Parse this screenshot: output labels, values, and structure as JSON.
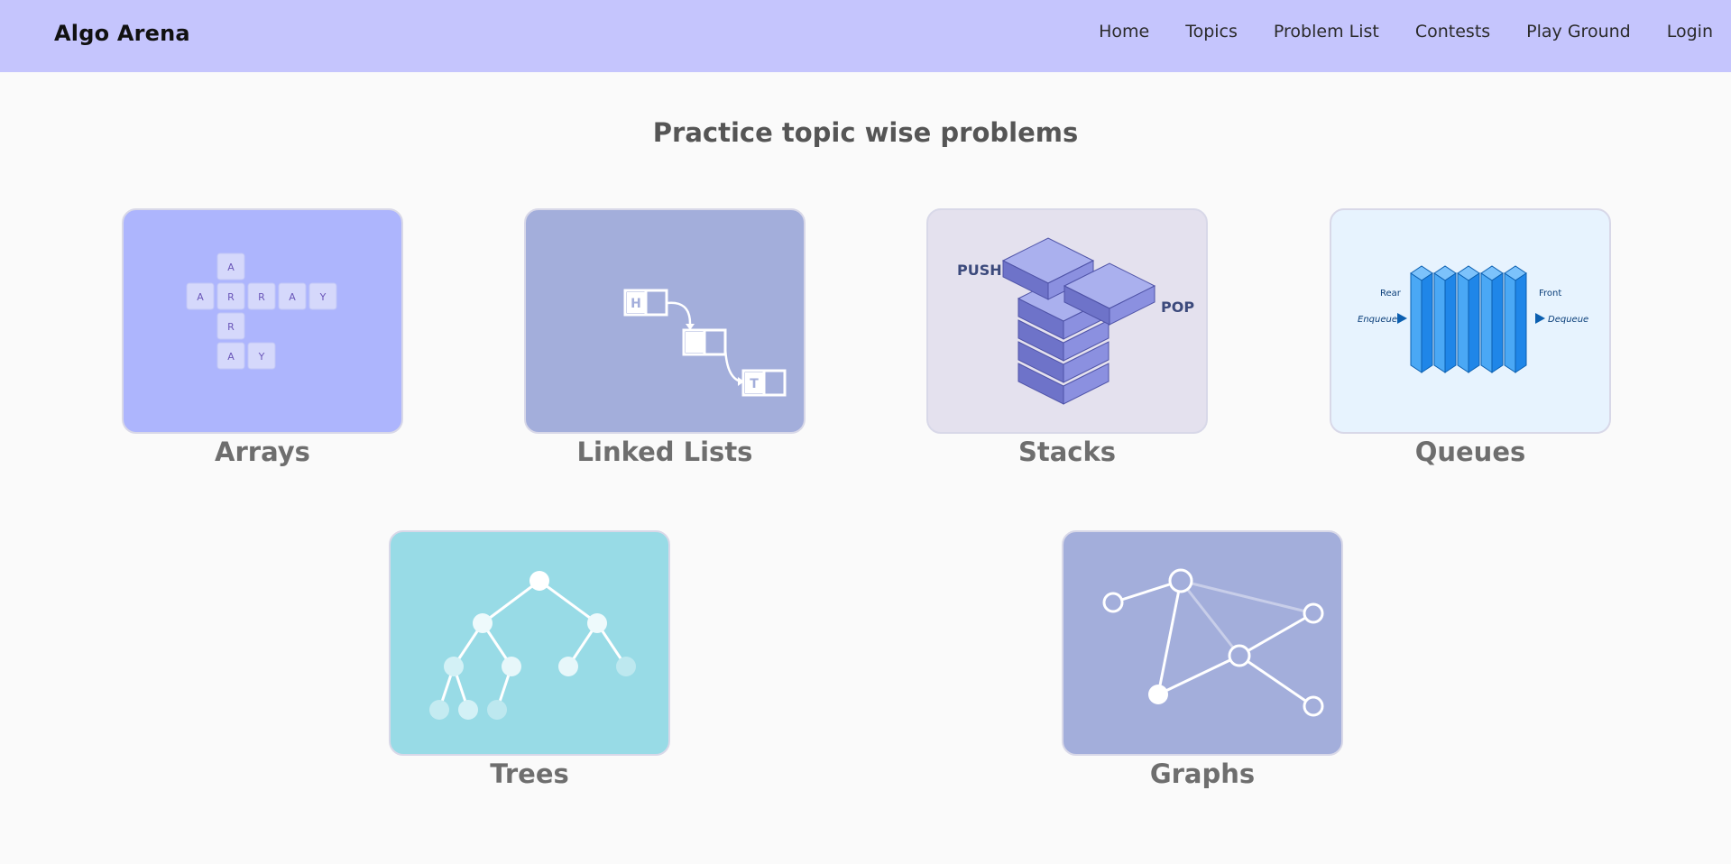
{
  "app": {
    "brand": "Algo Arena"
  },
  "nav": {
    "items": [
      {
        "label": "Home"
      },
      {
        "label": "Topics"
      },
      {
        "label": "Problem List"
      },
      {
        "label": "Contests"
      },
      {
        "label": "Play Ground"
      },
      {
        "label": "Login"
      }
    ]
  },
  "main": {
    "title": "Practice topic wise problems"
  },
  "topics": [
    {
      "name": "Arrays",
      "bg": "#adb5fd"
    },
    {
      "name": "Linked Lists",
      "bg": "#a3aedb"
    },
    {
      "name": "Stacks",
      "bg": "#e4e1ee"
    },
    {
      "name": "Queues",
      "bg": "#e7f3fe"
    },
    {
      "name": "Trees",
      "bg": "#98dbe6"
    },
    {
      "name": "Graphs",
      "bg": "#a3aedb"
    }
  ],
  "illustrations": {
    "arrays_letters": [
      "A",
      "A",
      "R",
      "R",
      "A",
      "Y",
      "R",
      "A",
      "Y"
    ],
    "linkedlist_head": "H",
    "linkedlist_tail": "T",
    "stack_push": "PUSH",
    "stack_pop": "POP",
    "queue_rear": "Rear",
    "queue_front": "Front",
    "queue_enqueue": "Enqueue",
    "queue_dequeue": "Dequeue"
  }
}
